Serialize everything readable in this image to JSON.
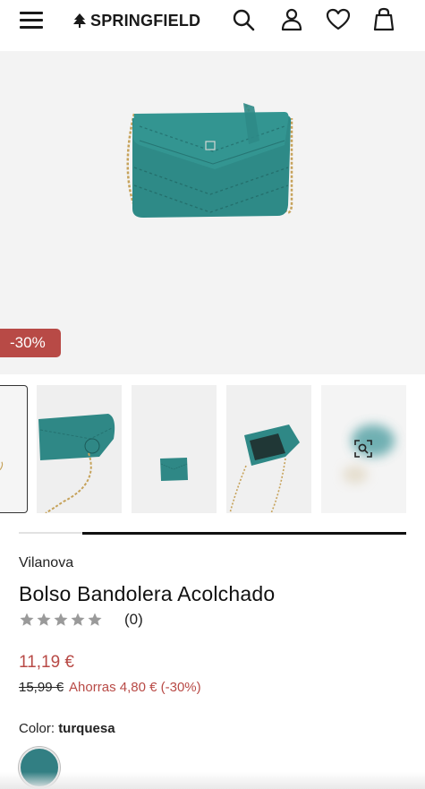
{
  "header": {
    "menu_icon": "hamburger-menu-icon",
    "logo_text": "SPRINGFIELD",
    "logo_icon": "tree-logo-icon",
    "icons": [
      "search-icon",
      "user-icon",
      "heart-icon",
      "bag-icon"
    ]
  },
  "main_image": {
    "discount_badge": "-30%",
    "subject": "bag-image"
  },
  "thumbnails": {
    "count_visible": 5,
    "last_overlay_icon": "zoom-search-icon"
  },
  "product": {
    "brand": "Vilanova",
    "title": "Bolso Bandolera Acolchado",
    "rating_stars": 5,
    "rating_value": 0,
    "review_count": "(0)",
    "price": "11,19 €",
    "old_price": "15,99 €",
    "savings": "Ahorras 4,80 € (-30%)",
    "color_label": "Color:",
    "color_name": "turquesa"
  },
  "colors": {
    "accent_red": "#b84a46",
    "swatch_teal": "#327f83"
  },
  "gallery_scroll_position": 0.14
}
